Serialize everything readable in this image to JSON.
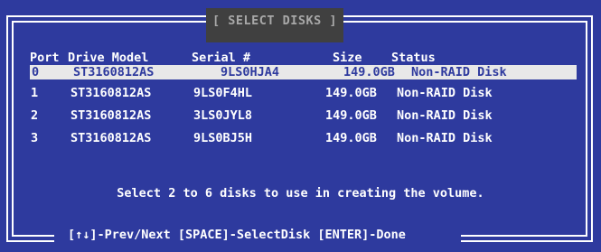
{
  "title": "[ SELECT DISKS ]",
  "columns": {
    "port": "Port",
    "drive_model": "Drive Model",
    "serial": "Serial #",
    "size": "Size",
    "status": "Status"
  },
  "disks": [
    {
      "port": "0",
      "model": "ST3160812AS",
      "serial": "9LS0HJA4",
      "size": "149.0GB",
      "status": "Non-RAID Disk",
      "selected": true
    },
    {
      "port": "1",
      "model": "ST3160812AS",
      "serial": "9LS0F4HL",
      "size": "149.0GB",
      "status": "Non-RAID Disk",
      "selected": false
    },
    {
      "port": "2",
      "model": "ST3160812AS",
      "serial": "3LS0JYL8",
      "size": "149.0GB",
      "status": "Non-RAID Disk",
      "selected": false
    },
    {
      "port": "3",
      "model": "ST3160812AS",
      "serial": "9LS0BJ5H",
      "size": "149.0GB",
      "status": "Non-RAID Disk",
      "selected": false
    }
  ],
  "message": "Select 2 to 6 disks to use in creating the volume.",
  "help": "[↑↓]-Prev/Next [SPACE]-SelectDisk [ENTER]-Done",
  "colors": {
    "background": "#2e3a9e",
    "highlight": "#e8e8e8",
    "title_bg": "#404040",
    "title_fg": "#a8a8a8"
  }
}
